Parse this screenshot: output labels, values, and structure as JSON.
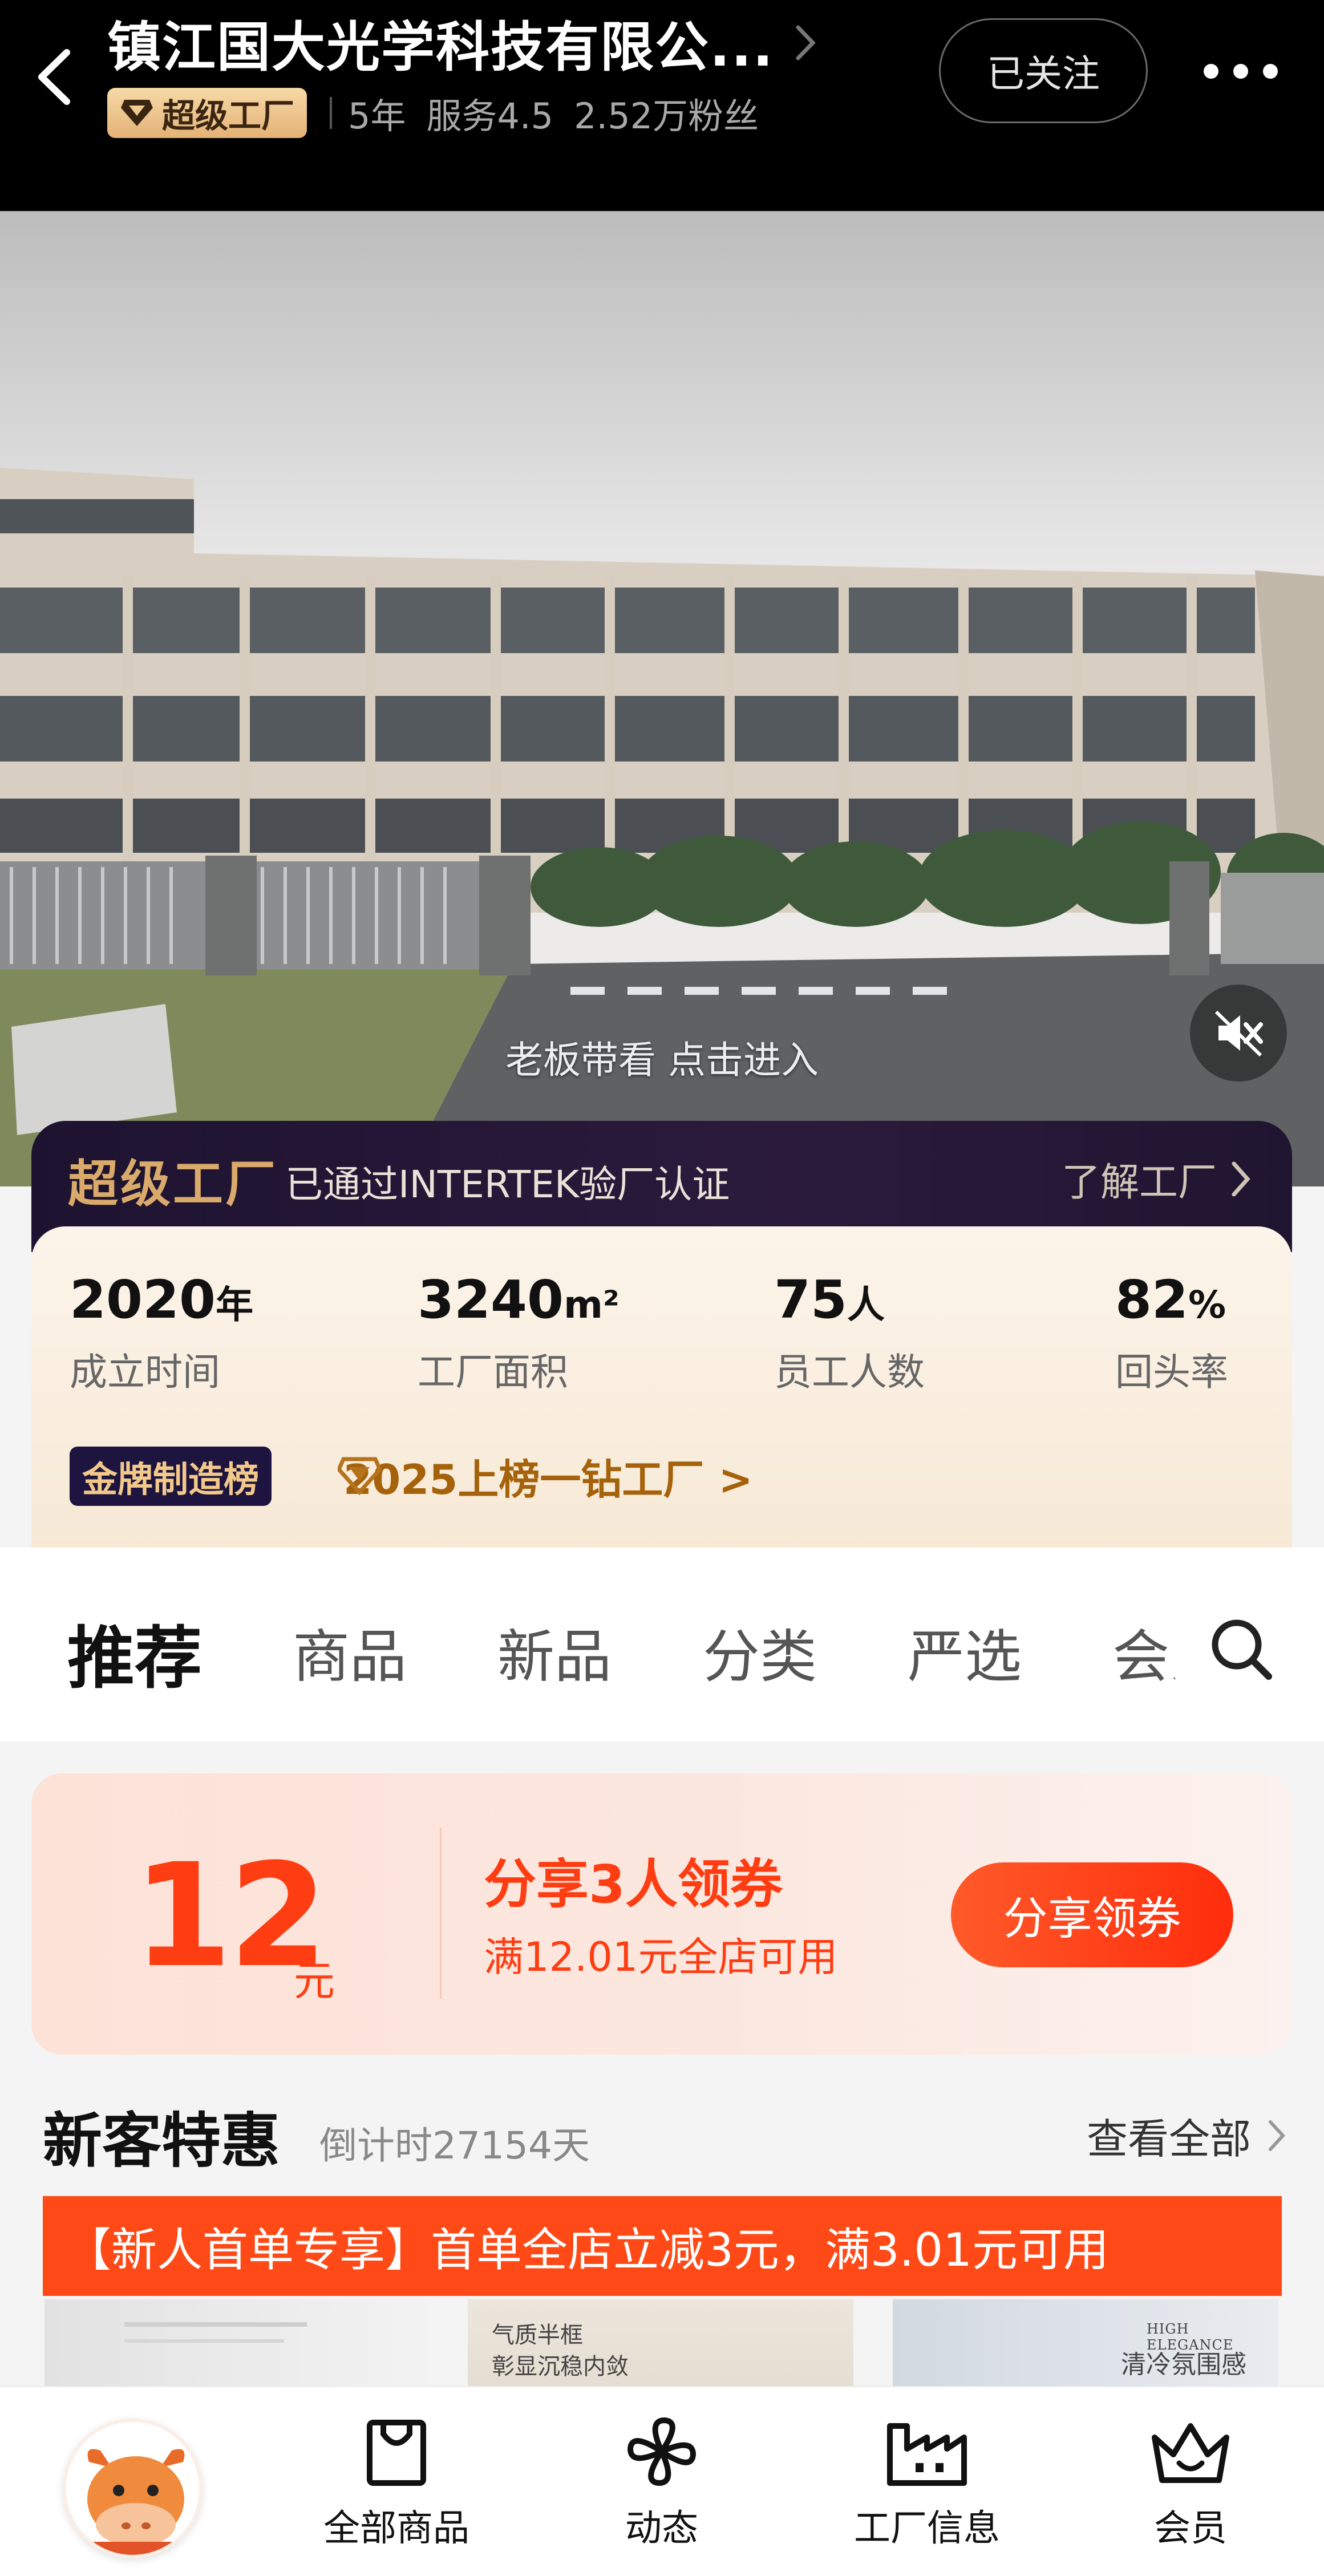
{
  "header": {
    "shop_name": "镇江国大光学科技有限公...",
    "badge_label": "超级工厂",
    "years": "5年",
    "service_score": "服务4.5",
    "followers": "2.52万粉丝",
    "follow_label": "已关注"
  },
  "video": {
    "caption": "老板带看 点击进入"
  },
  "factory": {
    "label": "超级工厂",
    "certification": "已通过INTERTEK验厂认证",
    "learn_more": "了解工厂",
    "stats": [
      {
        "value": "2020",
        "unit": "年",
        "label": "成立时间"
      },
      {
        "value": "3240",
        "unit": "m²",
        "label": "工厂面积"
      },
      {
        "value": "75",
        "unit": "人",
        "label": "员工人数"
      },
      {
        "value": "82",
        "unit": "%",
        "label": "回头率"
      }
    ],
    "ranking_badge": "金牌制造榜",
    "ranking_text": "2025上榜一钻工厂 >"
  },
  "tabs": [
    "推荐",
    "商品",
    "新品",
    "分类",
    "严选",
    "会员"
  ],
  "coupon": {
    "amount": "12",
    "unit": "元",
    "title": "分享3人领券",
    "condition": "满12.01元全店可用",
    "button_label": "分享领券"
  },
  "new_customer": {
    "title": "新客特惠",
    "countdown": "倒计时27154天",
    "view_all": "查看全部",
    "banner": "【新人首单专享】首单全店立减3元，满3.01元可用"
  },
  "thumbnails": [
    {
      "line1": "",
      "line2": ""
    },
    {
      "line1": "气质半框",
      "line2": "彰显沉稳内敛"
    },
    {
      "line1": "HIGH ELEGANCE",
      "line2": "清冷氛围感"
    }
  ],
  "bottom_nav": [
    {
      "label": "全部商品",
      "icon": "shopping-bag-icon"
    },
    {
      "label": "动态",
      "icon": "pinwheel-icon"
    },
    {
      "label": "工厂信息",
      "icon": "factory-icon"
    },
    {
      "label": "会员",
      "icon": "crown-icon"
    }
  ],
  "colors": {
    "accent": "#ff3d12",
    "gold": "#d9aa6a",
    "factory_band": "#1d1330"
  }
}
